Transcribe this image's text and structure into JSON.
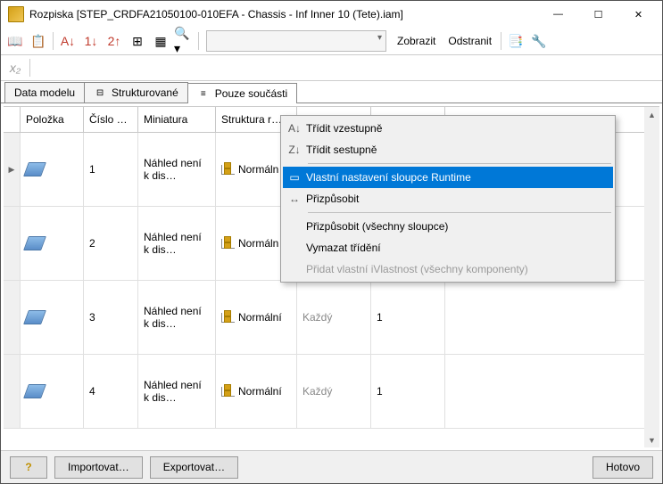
{
  "title": "Rozpiska [STEP_CRDFA21050100-010EFA - Chassis - Inf Inner 10 (Tete).iam]",
  "window": {
    "min": "—",
    "max": "☐",
    "close": "✕"
  },
  "toolbar_text": {
    "zobrazit": "Zobrazit",
    "odstranit": "Odstranit"
  },
  "tabs": {
    "data": "Data modelu",
    "structured": "Strukturované",
    "parts": "Pouze součásti"
  },
  "columns": {
    "polozka": "Položka",
    "cislo": "Číslo …",
    "miniatura": "Miniatura",
    "struktura": "Struktura r…",
    "jednotka": "",
    "mnozstvi": ""
  },
  "rows": [
    {
      "num": "1",
      "preview": "Náhled není k dis…",
      "struct": "Normáln",
      "jed": "",
      "mn": ""
    },
    {
      "num": "2",
      "preview": "Náhled není k dis…",
      "struct": "Normáln",
      "jed": "",
      "mn": ""
    },
    {
      "num": "3",
      "preview": "Náhled není k dis…",
      "struct": "Normální",
      "jed": "Každý",
      "mn": "1"
    },
    {
      "num": "4",
      "preview": "Náhled není k dis…",
      "struct": "Normální",
      "jed": "Každý",
      "mn": "1"
    }
  ],
  "menu": {
    "asc": "Třídit vzestupně",
    "desc": "Třídit sestupně",
    "custom": "Vlastní nastavení sloupce Runtime",
    "fit": "Přizpůsobit",
    "fitall": "Přizpůsobit (všechny sloupce)",
    "clear": "Vymazat třídění",
    "addprop": "Přidat vlastní iVlastnost (všechny komponenty)"
  },
  "footer": {
    "help": "?",
    "import": "Importovat…",
    "export": "Exportovat…",
    "done": "Hotovo"
  }
}
